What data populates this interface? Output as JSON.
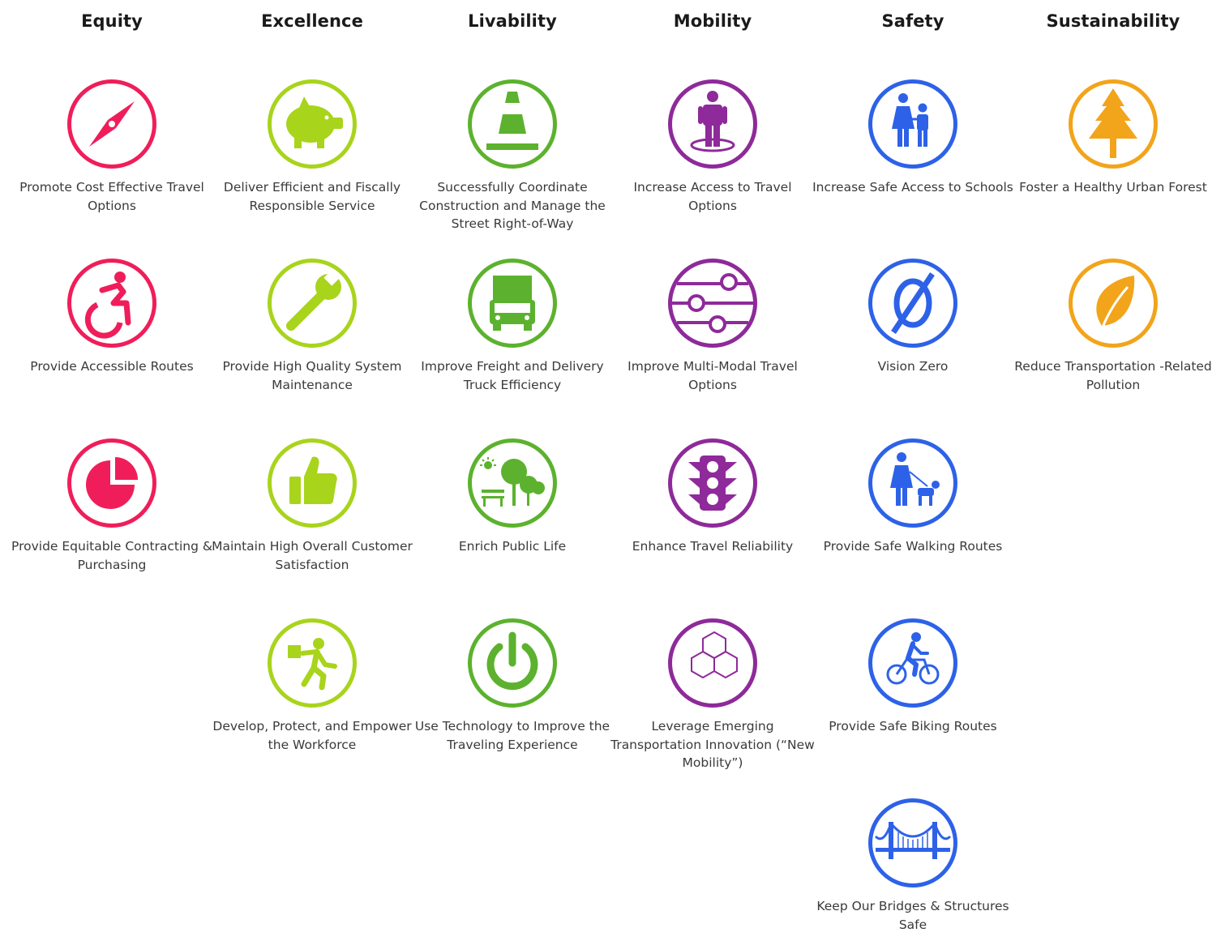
{
  "colors": {
    "equity": "#ef1e5a",
    "excellence": "#a8d41c",
    "livability": "#5cb22e",
    "mobility": "#8e2a9a",
    "safety": "#2d62e8",
    "sustainability": "#f2a41a"
  },
  "columns": [
    {
      "title": "Equity",
      "color": "#ef1e5a",
      "goals": [
        {
          "label": "Promote Cost Effective Travel Options",
          "icon": "compass-icon"
        },
        {
          "label": "Provide Accessible Routes",
          "icon": "wheelchair-icon"
        },
        {
          "label": "Provide Equitable Contracting & Purchasing",
          "icon": "pie-chart-icon"
        }
      ]
    },
    {
      "title": "Excellence",
      "color": "#a8d41c",
      "goals": [
        {
          "label": "Deliver Efficient and Fiscally Responsible Service",
          "icon": "piggy-bank-icon"
        },
        {
          "label": "Provide High Quality System Maintenance",
          "icon": "wrench-icon"
        },
        {
          "label": "Maintain High Overall Customer Satisfaction",
          "icon": "thumbs-up-icon"
        },
        {
          "label": "Develop, Protect, and Empower the Workforce",
          "icon": "worker-carrying-box-icon"
        }
      ]
    },
    {
      "title": "Livability",
      "color": "#5cb22e",
      "goals": [
        {
          "label": "Successfully Coordinate Construction and Manage the Street Right-of-Way",
          "icon": "traffic-cone-icon"
        },
        {
          "label": "Improve Freight and Delivery Truck Efficiency",
          "icon": "truck-icon"
        },
        {
          "label": "Enrich Public Life",
          "icon": "park-trees-icon"
        },
        {
          "label": "Use Technology to Improve the Traveling Experience",
          "icon": "power-icon"
        }
      ]
    },
    {
      "title": "Mobility",
      "color": "#8e2a9a",
      "goals": [
        {
          "label": "Increase Access to Travel Options",
          "icon": "person-standing-icon"
        },
        {
          "label": "Improve Multi-Modal Travel Options",
          "icon": "sliders-icon"
        },
        {
          "label": "Enhance Travel Reliability",
          "icon": "traffic-light-icon"
        },
        {
          "label": "Leverage Emerging Transportation Innovation (“New Mobility”)",
          "icon": "hexagons-icon"
        }
      ]
    },
    {
      "title": "Safety",
      "color": "#2d62e8",
      "goals": [
        {
          "label": "Increase Safe Access to Schools",
          "icon": "children-icon"
        },
        {
          "label": "Vision Zero",
          "icon": "empty-set-icon"
        },
        {
          "label": "Provide Safe Walking Routes",
          "icon": "person-walking-dog-icon"
        },
        {
          "label": "Provide Safe Biking Routes",
          "icon": "cyclist-icon"
        },
        {
          "label": "Keep Our Bridges & Structures Safe",
          "icon": "bridge-icon"
        }
      ]
    },
    {
      "title": "Sustainability",
      "color": "#f2a41a",
      "goals": [
        {
          "label": "Foster a Healthy Urban Forest",
          "icon": "tree-icon"
        },
        {
          "label": "Reduce Transportation -Related Pollution",
          "icon": "leaf-icon"
        }
      ]
    }
  ]
}
